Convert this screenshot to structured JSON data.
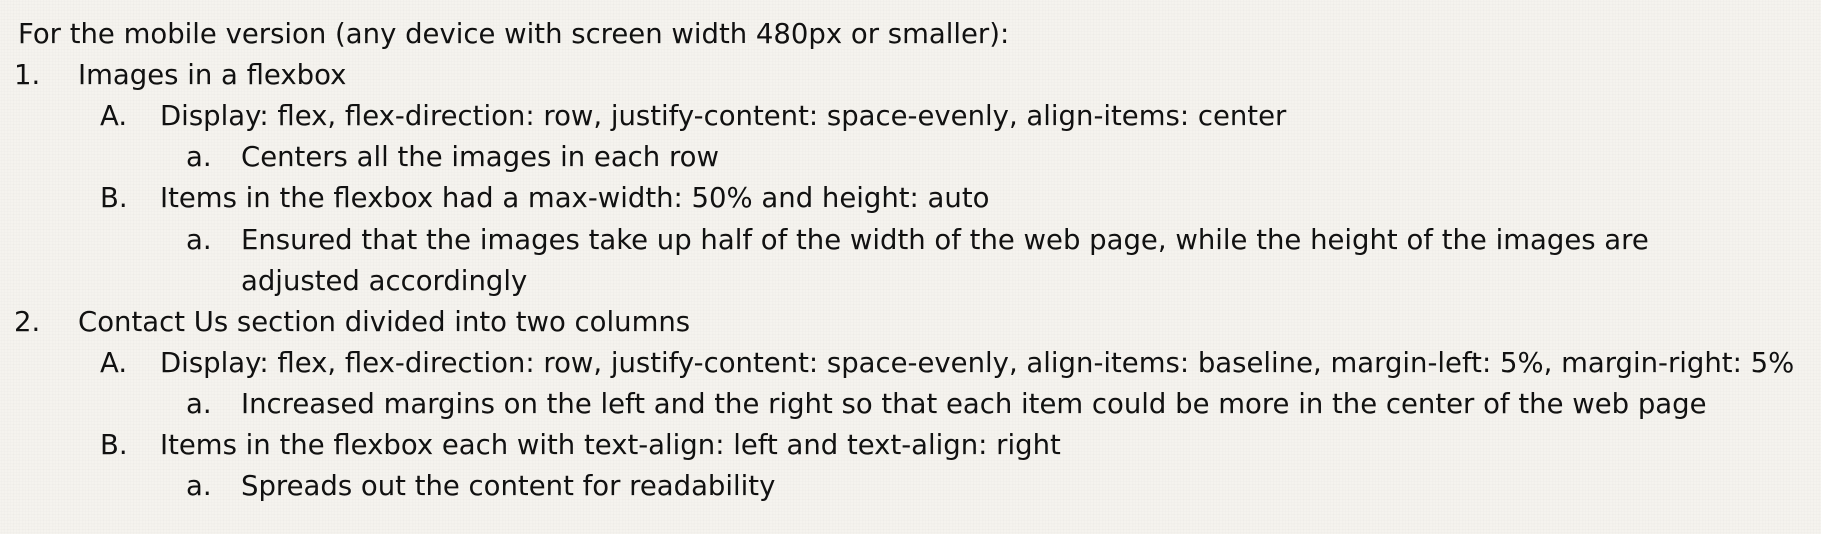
{
  "intro": "For the mobile version (any device with screen width 480px or smaller):",
  "items": [
    {
      "marker": "1.",
      "text": "Images in a flexbox",
      "sub": [
        {
          "marker": "A.",
          "text": "Display: flex, flex-direction: row, justify-content: space-evenly, align-items: center",
          "sub": [
            {
              "marker": "a.",
              "text": "Centers all the images in each row"
            }
          ]
        },
        {
          "marker": "B.",
          "text": "Items in the flexbox had a max-width: 50% and height: auto",
          "sub": [
            {
              "marker": "a.",
              "text": "Ensured that the images take up half of the width of the web page, while the height of the images are",
              "continuation": "adjusted accordingly"
            }
          ]
        }
      ]
    },
    {
      "marker": "2.",
      "text": "Contact Us section divided into two columns",
      "sub": [
        {
          "marker": "A.",
          "text": "Display: flex, flex-direction: row, justify-content: space-evenly, align-items: baseline, margin-left: 5%, margin-right: 5%",
          "sub": [
            {
              "marker": "a.",
              "text": "Increased margins on the left and the right so that each item could be more in the center of the web page"
            }
          ]
        },
        {
          "marker": "B.",
          "text": "Items in the flexbox each with text-align: left and text-align: right",
          "sub": [
            {
              "marker": "a.",
              "text": "Spreads out the content for readability"
            }
          ]
        }
      ]
    }
  ]
}
